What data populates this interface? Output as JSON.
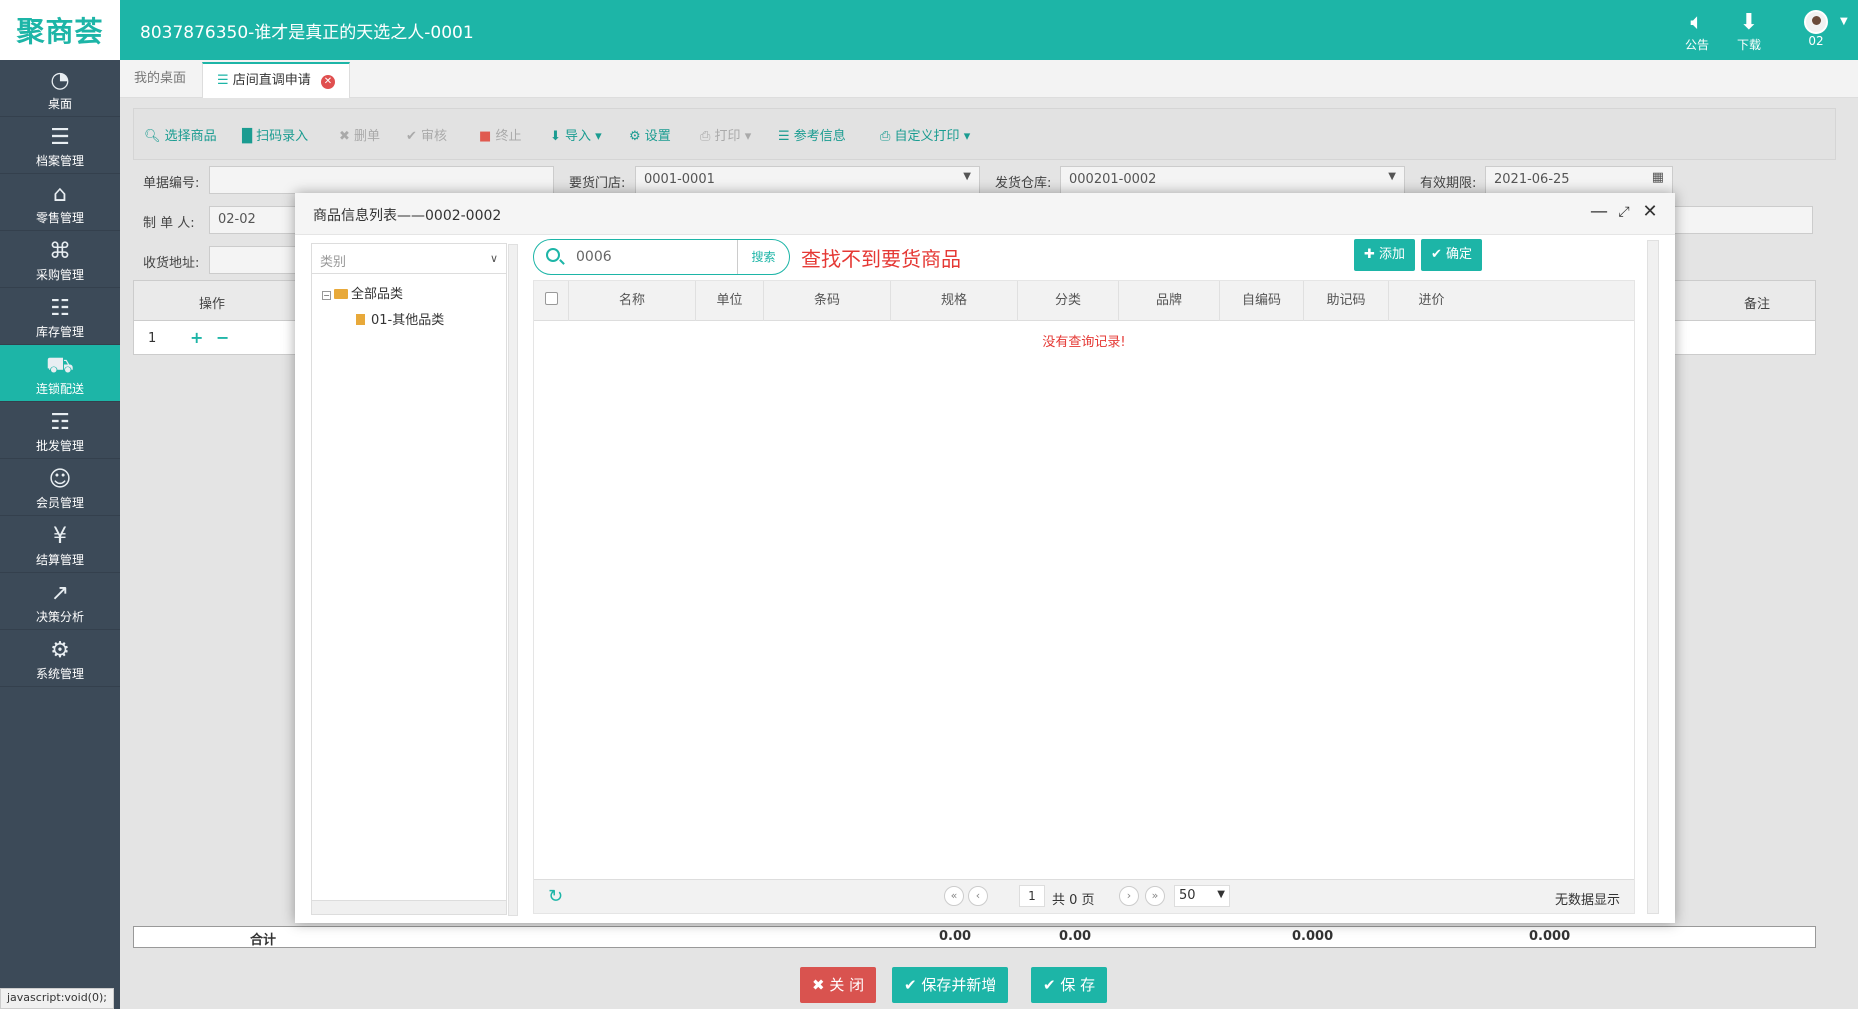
{
  "header": {
    "logo": "聚商荟",
    "title": "8037876350-谁才是真正的天选之人-0001",
    "notice_label": "公告",
    "download_label": "下载",
    "user_label": "02",
    "accent": "#1db5a7"
  },
  "sidebar": {
    "items": [
      {
        "label": "桌面",
        "icon": "dashboard-icon"
      },
      {
        "label": "档案管理",
        "icon": "archive-icon"
      },
      {
        "label": "零售管理",
        "icon": "store-icon"
      },
      {
        "label": "采购管理",
        "icon": "purchase-icon"
      },
      {
        "label": "库存管理",
        "icon": "inventory-icon"
      },
      {
        "label": "连锁配送",
        "icon": "truck-icon"
      },
      {
        "label": "批发管理",
        "icon": "wholesale-icon"
      },
      {
        "label": "会员管理",
        "icon": "member-icon"
      },
      {
        "label": "结算管理",
        "icon": "settlement-icon"
      },
      {
        "label": "决策分析",
        "icon": "chart-icon"
      },
      {
        "label": "系统管理",
        "icon": "gear-icon"
      }
    ],
    "active_index": 5
  },
  "tabs": [
    {
      "label": "我的桌面"
    },
    {
      "label": "店间直调申请"
    }
  ],
  "toolbar": {
    "select_goods": "选择商品",
    "scan_entry": "扫码录入",
    "delete": "删单",
    "audit": "审核",
    "stop": "终止",
    "import": "导入",
    "settings": "设置",
    "print": "打印",
    "reference": "参考信息",
    "custom_print": "自定义打印"
  },
  "form": {
    "doc_no_label": "单据编号:",
    "req_store_label": "要货门店:",
    "req_store_value": "0001-0001",
    "ship_wh_label": "发货仓库:",
    "ship_wh_value": "000201-0002",
    "expiry_label": "有效期限:",
    "expiry_value": "2021-06-25",
    "maker_label": "制 单 人:",
    "maker_value": "02-02",
    "address_label": "收货地址:"
  },
  "bg_grid": {
    "op_header": "操作",
    "remark_header": "备注",
    "row_no": "1"
  },
  "summary": {
    "label": "合计",
    "values": [
      "0.00",
      "0.00",
      "0.000",
      "0.000"
    ]
  },
  "bottom_buttons": {
    "close": "关 闭",
    "save_new": "保存并新增",
    "save": "保 存"
  },
  "status_bar": "javascript:void(0);",
  "modal": {
    "title": "商品信息列表——0002-0002",
    "category_placeholder": "类别",
    "tree": {
      "root": "全部品类",
      "child": "01-其他品类"
    },
    "search_value": "0006",
    "search_button": "搜索",
    "annotation": "查找不到要货商品",
    "add_button": "添加",
    "confirm_button": "确定",
    "columns": [
      "名称",
      "单位",
      "条码",
      "规格",
      "分类",
      "品牌",
      "自编码",
      "助记码",
      "进价"
    ],
    "no_records": "没有查询记录!",
    "pager": {
      "page": "1",
      "total_pages": "共 0 页",
      "page_size": "50",
      "no_data": "无数据显示"
    }
  }
}
